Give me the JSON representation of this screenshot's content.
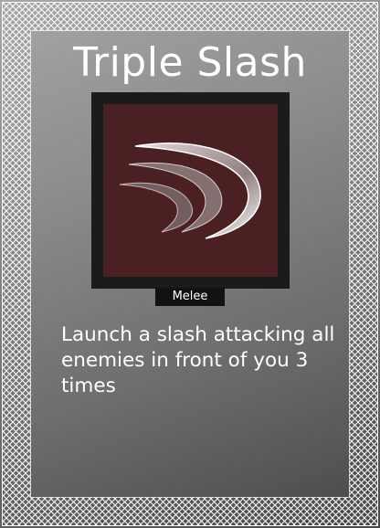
{
  "card": {
    "title": "Triple Slash",
    "type_label": "Melee",
    "description": "Launch a slash attacking all enemies in front of you 3 times",
    "art_icon": "triple-slash-icon"
  },
  "colors": {
    "art_background": "#4b2023",
    "art_frame": "#1b1b1b",
    "border_pattern": "#ffffff",
    "badge_background": "#121212"
  }
}
